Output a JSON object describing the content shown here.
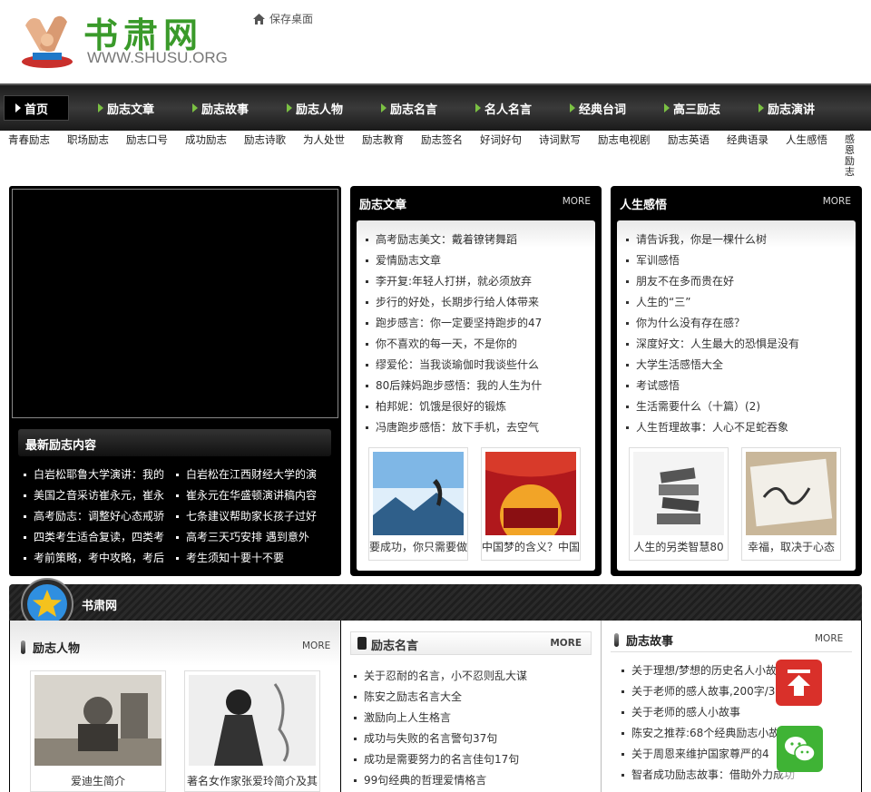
{
  "header": {
    "logo_cn": "书肃网",
    "logo_en": "WWW.SHUSU.ORG",
    "save_desktop": "保存桌面"
  },
  "nav": {
    "items": [
      "首页",
      "励志文章",
      "励志故事",
      "励志人物",
      "励志名言",
      "名人名言",
      "经典台词",
      "高三励志",
      "励志演讲"
    ]
  },
  "subnav": {
    "items": [
      "青春励志",
      "职场励志",
      "励志口号",
      "成功励志",
      "励志诗歌",
      "为人处世",
      "励志教育",
      "励志签名",
      "好词好句",
      "诗词默写",
      "励志电视剧",
      "励志英语",
      "经典语录",
      "人生感悟"
    ],
    "vertical": "感恩励志"
  },
  "latest": {
    "title": "最新励志内容",
    "left": [
      "白岩松耶鲁大学演讲：我的",
      "美国之音采访崔永元，崔永",
      "高考励志：调整好心态戒骄",
      "四类考生适合复读，四类考",
      "考前策略，考中攻略，考后"
    ],
    "right": [
      "白岩松在江西财经大学的演",
      "崔永元在华盛顿演讲稿内容",
      "七条建议帮助家长孩子过好",
      "高考三天巧安排 遇到意外",
      "考生须知十要十不要"
    ]
  },
  "articles": {
    "title": "励志文章",
    "more": "MORE",
    "items": [
      "高考励志美文：戴着镣铐舞蹈",
      "爱情励志文章",
      "李开复:年轻人打拼，就必须放弃",
      "步行的好处，长期步行给人体带来",
      "跑步感言：你一定要坚持跑步的47",
      "你不喜欢的每一天，不是你的",
      "缪爱伦：当我谈瑜伽时我谈些什么",
      "80后辣妈跑步感悟：我的人生为什",
      "柏邦妮：饥饿是很好的锻炼",
      "冯唐跑步感悟：放下手机，去空气"
    ],
    "thumbs": [
      "要成功，你只需要做",
      "中国梦的含义？中国"
    ]
  },
  "life": {
    "title": "人生感悟",
    "more": "MORE",
    "items": [
      "请告诉我，你是一棵什么树",
      "军训感悟",
      "朋友不在多而贵在好",
      "人生的“三”",
      "你为什么没有存在感？",
      "深度好文：人生最大的恐惧是没有",
      "大学生活感悟大全",
      "考试感悟",
      "生活需要什么（十篇）(2)",
      "人生哲理故事：人心不足蛇吞象"
    ],
    "thumbs": [
      "人生的另类智慧80",
      "幸福，取决于心态"
    ]
  },
  "bottom": {
    "site_title": "书肃网",
    "people": {
      "title": "励志人物",
      "more": "MORE",
      "thumbs": [
        "爱迪生简介",
        "著名女作家张爱玲简介及其"
      ]
    },
    "quotes": {
      "title": "励志名言",
      "more": "MORE",
      "items": [
        "关于忍耐的名言，小不忍则乱大谋",
        "陈安之励志名言大全",
        "激励向上人生格言",
        "成功与失败的名言警句37句",
        "成功是需要努力的名言佳句17句",
        "99句经典的哲理爱情格言"
      ]
    },
    "stories": {
      "title": "励志故事",
      "more": "MORE",
      "items": [
        "关于理想/梦想的历史名人小故",
        "关于老师的感人故事,200字/3",
        "关于老师的感人小故事",
        "陈安之推荐:68个经典励志小故",
        "关于周恩来维护国家尊严的4",
        "智者成功励志故事：借助外力成功"
      ]
    }
  },
  "colors": {
    "brand_green": "#3a9a2a",
    "nav_arrow": "#7bc143",
    "top_button": "#d9302a",
    "wechat_button": "#3fb335"
  }
}
